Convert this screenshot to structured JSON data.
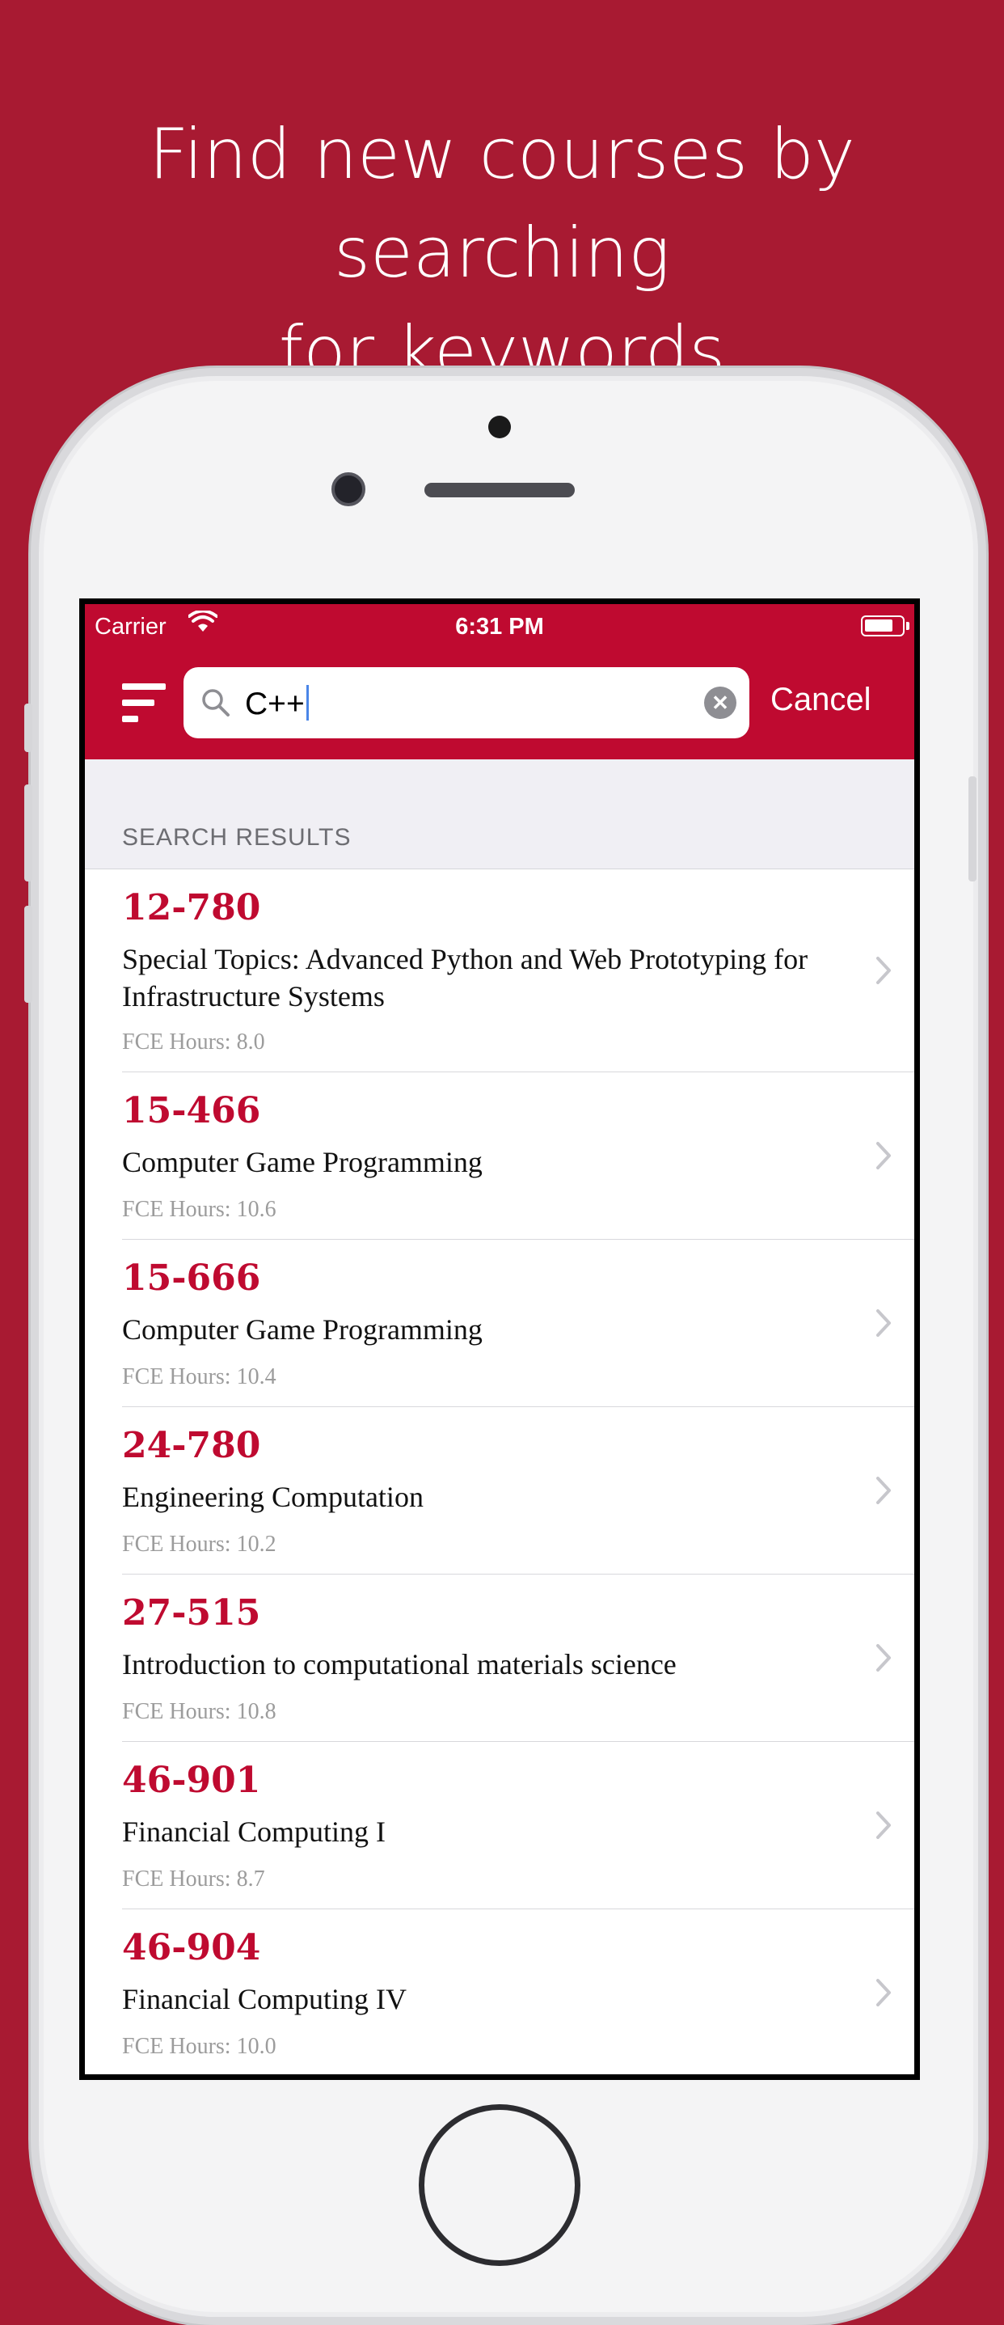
{
  "headline": {
    "line1": "Find new courses by searching",
    "line2": "for keywords"
  },
  "status_bar": {
    "carrier": "Carrier",
    "time": "6:31 PM"
  },
  "search": {
    "query": "C++",
    "cancel_label": "Cancel"
  },
  "section_title": "SEARCH RESULTS",
  "hours_prefix": "FCE Hours: ",
  "results": [
    {
      "number": "12-780",
      "title": "Special Topics: Advanced Python and Web Prototyping for Infrastructure Systems",
      "hours": "FCE Hours: 8.0"
    },
    {
      "number": "15-466",
      "title": "Computer Game Programming",
      "hours": "FCE Hours: 10.6"
    },
    {
      "number": "15-666",
      "title": "Computer Game Programming",
      "hours": "FCE Hours: 10.4"
    },
    {
      "number": "24-780",
      "title": "Engineering Computation",
      "hours": "FCE Hours: 10.2"
    },
    {
      "number": "27-515",
      "title": "Introduction to computational materials science",
      "hours": "FCE Hours: 10.8"
    },
    {
      "number": "46-901",
      "title": "Financial Computing I",
      "hours": "FCE Hours: 8.7"
    },
    {
      "number": "46-904",
      "title": "Financial Computing IV",
      "hours": "FCE Hours: 10.0"
    }
  ],
  "colors": {
    "background": "#a81a32",
    "navbar": "#bf0a30",
    "accent": "#bf0a30"
  }
}
